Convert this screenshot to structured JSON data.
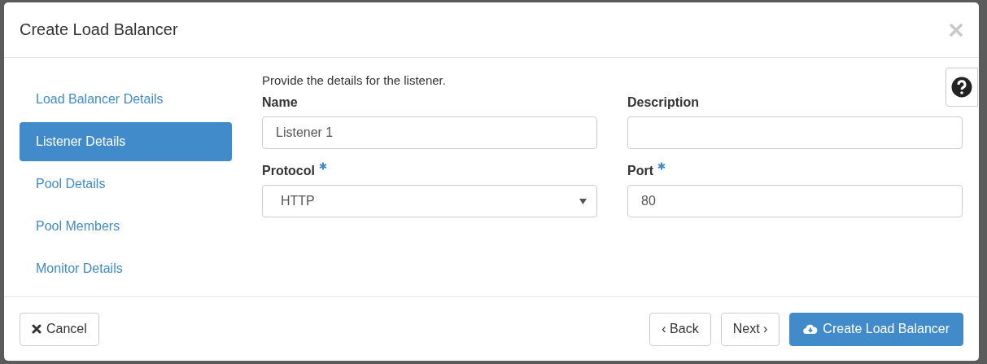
{
  "dialog": {
    "title": "Create Load Balancer"
  },
  "steps": [
    {
      "label": "Load Balancer Details",
      "selected": false
    },
    {
      "label": "Listener Details",
      "selected": true
    },
    {
      "label": "Pool Details",
      "selected": false
    },
    {
      "label": "Pool Members",
      "selected": false
    },
    {
      "label": "Monitor Details",
      "selected": false
    }
  ],
  "intro": "Provide the details for the listener.",
  "fields": [
    {
      "kind": "text",
      "label": "Name",
      "required": false,
      "value": "Listener 1"
    },
    {
      "kind": "text",
      "label": "Description",
      "required": false
    },
    {
      "kind": "select",
      "label": "Protocol",
      "required": true,
      "value": "HTTP"
    },
    {
      "kind": "text",
      "label": "Port",
      "required": true,
      "value": "80"
    }
  ],
  "buttons": [
    {
      "kind": "cancel",
      "label": "Cancel"
    },
    {
      "kind": "back",
      "label": "‹ Back"
    },
    {
      "kind": "next",
      "label": "Next ›"
    },
    {
      "kind": "create",
      "label": "Create Load Balancer"
    }
  ]
}
